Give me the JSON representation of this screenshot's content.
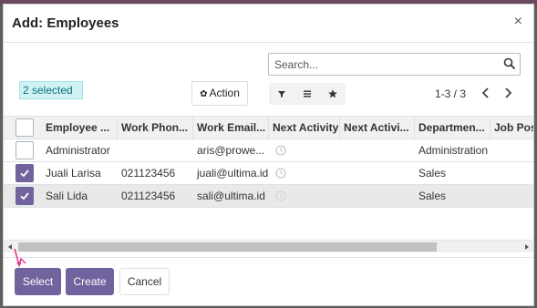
{
  "dialog": {
    "title": "Add: Employees",
    "close_icon": "×"
  },
  "search": {
    "placeholder": "Search..."
  },
  "selection": {
    "label": "2 selected"
  },
  "toolbar": {
    "action_label": "Action",
    "filter_icons": [
      "filter-icon",
      "group-by-icon",
      "favorite-icon"
    ]
  },
  "pager": {
    "text": "1-3 / 3"
  },
  "table": {
    "columns": [
      "Employee ...",
      "Work Phon...",
      "Work Email...",
      "Next Activity",
      "Next Activi...",
      "Departmen...",
      "Job Pos"
    ],
    "rows": [
      {
        "checked": false,
        "name": "Administrator",
        "phone": "",
        "email": "aris@prowe...",
        "department": "Administration"
      },
      {
        "checked": true,
        "name": "Juali Larisa",
        "phone": "021123456",
        "email": "juali@ultima.id",
        "department": "Sales"
      },
      {
        "checked": true,
        "name": "Sali Lida",
        "phone": "021123456",
        "email": "sali@ultima.id",
        "department": "Sales"
      }
    ]
  },
  "footer": {
    "select_label": "Select",
    "create_label": "Create",
    "cancel_label": "Cancel"
  },
  "colors": {
    "primary": "#71639e",
    "badge_bg": "#d1f2f5",
    "badge_text": "#0c6f7a",
    "cursor": "#e0338a"
  }
}
